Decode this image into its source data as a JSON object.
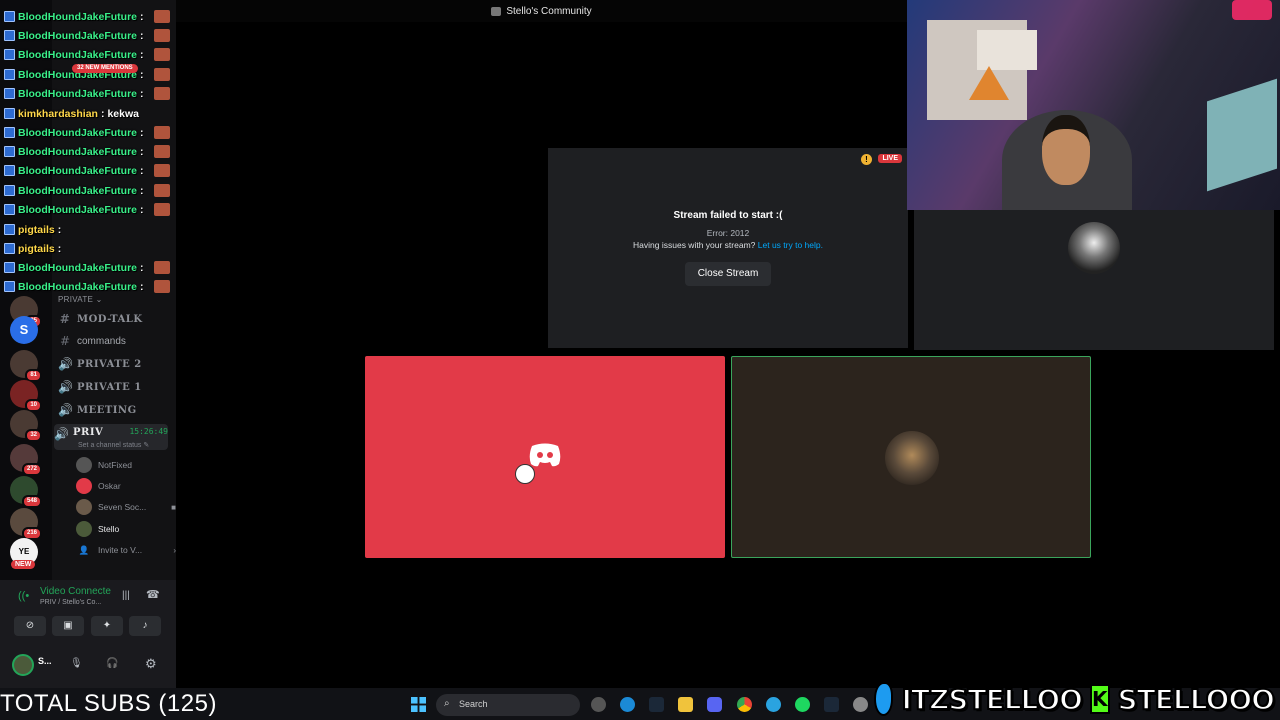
{
  "window": {
    "title": "Stello's Community"
  },
  "chat": {
    "messages": [
      {
        "user": "BloodHoundJakeFuture",
        "sep": ":",
        "text": "",
        "emote": true
      },
      {
        "user": "BloodHoundJakeFuture",
        "sep": ":",
        "text": "",
        "emote": true
      },
      {
        "user": "BloodHoundJakeFuture",
        "sep": ":",
        "text": "",
        "emote": true
      },
      {
        "user": "BloodHoundJakeFuture",
        "sep": ":",
        "text": "",
        "emote": true
      },
      {
        "user": "BloodHoundJakeFuture",
        "sep": ":",
        "text": "",
        "emote": true
      },
      {
        "user": "kimkhardashian",
        "sep": ":",
        "text": "kekwa",
        "emote": false
      },
      {
        "user": "BloodHoundJakeFuture",
        "sep": ":",
        "text": "",
        "emote": true
      },
      {
        "user": "BloodHoundJakeFuture",
        "sep": ":",
        "text": "",
        "emote": true
      },
      {
        "user": "BloodHoundJakeFuture",
        "sep": ":",
        "text": "",
        "emote": true
      },
      {
        "user": "BloodHoundJakeFuture",
        "sep": ":",
        "text": "",
        "emote": true
      },
      {
        "user": "BloodHoundJakeFuture",
        "sep": ":",
        "text": "",
        "emote": true
      },
      {
        "user": "pigtails",
        "sep": ":",
        "text": "",
        "emote": false
      },
      {
        "user": "pigtails",
        "sep": ":",
        "text": "",
        "emote": false
      },
      {
        "user": "BloodHoundJakeFuture",
        "sep": ":",
        "text": "",
        "emote": true
      },
      {
        "user": "BloodHoundJakeFuture",
        "sep": ":",
        "text": "",
        "emote": true
      }
    ]
  },
  "rail": {
    "mentions_pill": "32 NEW MENTIONS",
    "servers": [
      {
        "badge": "25"
      },
      {
        "label": "S",
        "badge": ""
      },
      {
        "badge": "81"
      },
      {
        "badge": "10"
      },
      {
        "badge": "32"
      },
      {
        "badge": "272"
      },
      {
        "badge": "548"
      },
      {
        "badge": "216"
      },
      {
        "label": "YE",
        "badge": ""
      }
    ],
    "new_label": "NEW"
  },
  "channels": {
    "private_header": "PRIVATE",
    "items": [
      {
        "sym": "#",
        "name": "MOD-TALK"
      },
      {
        "sym": "#",
        "name": "commands"
      },
      {
        "sym": "🔊",
        "name": "PRIVATE 2"
      },
      {
        "sym": "🔊",
        "name": "PRIVATE 1"
      },
      {
        "sym": "🔊",
        "name": "MEETING"
      }
    ],
    "active": {
      "sym": "🔊",
      "name": "PRIV",
      "time": "15:26:49",
      "status": "Set a channel status"
    },
    "voice_users": [
      "NotFixed",
      "Oskar",
      "Seven Soc...",
      "Stello"
    ],
    "invite": "Invite to V..."
  },
  "voice_panel": {
    "status": "Video Connecte",
    "location": "PRIV / Stello's Co...",
    "user_short": "S..."
  },
  "stage": {
    "live": "LIVE",
    "error_title": "Stream failed to start :(",
    "error_code": "Error: 2012",
    "help_text": "Having issues with your stream?",
    "help_link": "Let us try to help.",
    "close_button": "Close Stream"
  },
  "overlay": {
    "subs": "TOTAL SUBS (125)",
    "twitter_handle": "ITZSTELLOO",
    "kick_handle": "STELLOOO",
    "kick_letter": "K"
  },
  "taskbar": {
    "search_placeholder": "Search"
  },
  "colors": {
    "accent_green": "#3ba55c",
    "danger_red": "#da373c",
    "red_tile": "#e23a48",
    "link_blue": "#00a8fc"
  }
}
